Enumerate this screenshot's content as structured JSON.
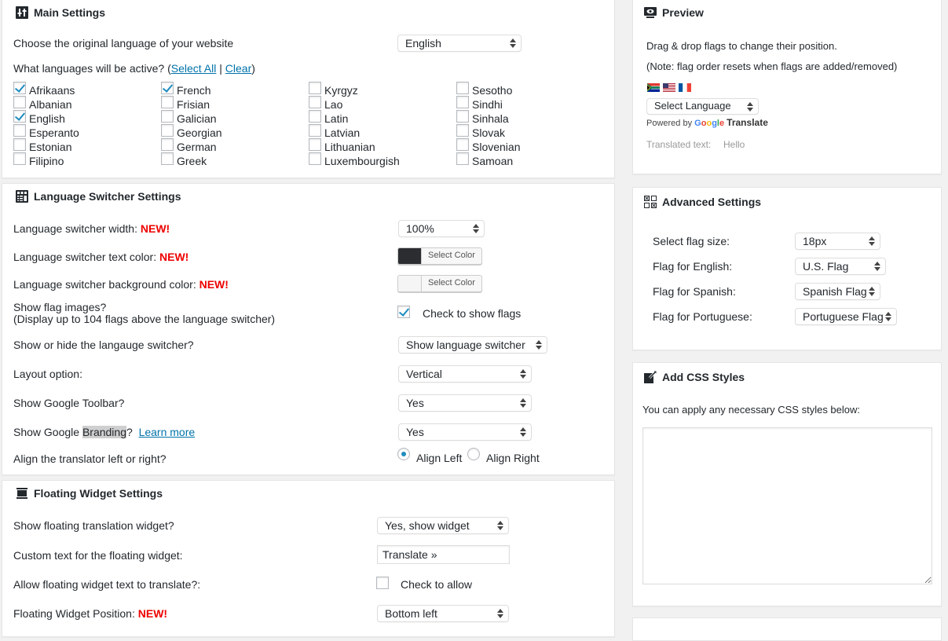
{
  "main_settings": {
    "title": "Main Settings",
    "icon": "sliders-icon",
    "original_language_label": "Choose the original language of your website",
    "original_language_value": "English",
    "active_languages_label": "What languages will be active? (",
    "select_all": "Select All",
    "separator": " | ",
    "clear": "Clear",
    "close_paren": ")",
    "languages": [
      [
        {
          "name": "Afrikaans",
          "checked": true
        },
        {
          "name": "Albanian",
          "checked": false
        },
        {
          "name": "English",
          "checked": true
        },
        {
          "name": "Esperanto",
          "checked": false
        },
        {
          "name": "Estonian",
          "checked": false
        },
        {
          "name": "Filipino",
          "checked": false
        }
      ],
      [
        {
          "name": "French",
          "checked": true
        },
        {
          "name": "Frisian",
          "checked": false
        },
        {
          "name": "Galician",
          "checked": false
        },
        {
          "name": "Georgian",
          "checked": false
        },
        {
          "name": "German",
          "checked": false
        },
        {
          "name": "Greek",
          "checked": false
        }
      ],
      [
        {
          "name": "Kyrgyz",
          "checked": false
        },
        {
          "name": "Lao",
          "checked": false
        },
        {
          "name": "Latin",
          "checked": false
        },
        {
          "name": "Latvian",
          "checked": false
        },
        {
          "name": "Lithuanian",
          "checked": false
        },
        {
          "name": "Luxembourgish",
          "checked": false
        }
      ],
      [
        {
          "name": "Sesotho",
          "checked": false
        },
        {
          "name": "Sindhi",
          "checked": false
        },
        {
          "name": "Sinhala",
          "checked": false
        },
        {
          "name": "Slovak",
          "checked": false
        },
        {
          "name": "Slovenian",
          "checked": false
        },
        {
          "name": "Samoan",
          "checked": false
        }
      ]
    ]
  },
  "switcher_settings": {
    "title": "Language Switcher Settings",
    "icon": "table-layout-icon",
    "new_badge": "NEW!",
    "width_label": "Language switcher width: ",
    "width_value": "100%",
    "text_color_label": "Language switcher text color: ",
    "text_color_value": "#2b2d31",
    "bg_color_label": "Language switcher background color: ",
    "bg_color_value": "#f5f5f5",
    "select_color": "Select Color",
    "show_flags_label_1": "Show flag images?",
    "show_flags_label_2": "(Display up to 104 flags above the language switcher)",
    "show_flags_checkbox": "Check to show flags",
    "show_flags_checked": true,
    "show_hide_label": "Show or hide the langauge switcher?",
    "show_hide_value": "Show language switcher",
    "layout_label": "Layout option:",
    "layout_value": "Vertical",
    "toolbar_label": "Show Google Toolbar?",
    "toolbar_value": "Yes",
    "branding_label_pre": "Show Google ",
    "branding_label_hl": "Branding",
    "branding_label_post": "?",
    "learn_more": "Learn more",
    "branding_value": "Yes",
    "align_label": "Align the translator left or right?",
    "align_left": "Align Left",
    "align_right": "Align Right",
    "align_selected": "left"
  },
  "floating_settings": {
    "title": "Floating Widget Settings",
    "icon": "floating-widget-icon",
    "show_widget_label": "Show floating translation widget?",
    "show_widget_value": "Yes, show widget",
    "custom_text_label": "Custom text for the floating widget:",
    "custom_text_value": "Translate »",
    "allow_translate_label": "Allow floating widget text to translate?:",
    "allow_translate_checkbox": "Check to allow",
    "allow_translate_checked": false,
    "position_label": "Floating Widget Position: ",
    "new_badge": "NEW!",
    "position_value": "Bottom left"
  },
  "preview": {
    "title": "Preview",
    "icon": "preview-screen-icon",
    "instructions": "Drag & drop flags to change their position.",
    "note": "(Note: flag order resets when flags are added/removed)",
    "flags": [
      "south-africa-flag-icon",
      "usa-flag-icon",
      "france-flag-icon"
    ],
    "select_language": "Select Language",
    "powered_by": "Powered by ",
    "google": "Google",
    "translate": "Translate",
    "translated_label": "Translated text:",
    "translated_value": "Hello"
  },
  "advanced": {
    "title": "Advanced Settings",
    "icon": "grid-icon",
    "flag_size_label": "Select flag size:",
    "flag_size_value": "18px",
    "flag_english_label": "Flag for English:",
    "flag_english_value": "U.S. Flag",
    "flag_spanish_label": "Flag for Spanish:",
    "flag_spanish_value": "Spanish Flag",
    "flag_portuguese_label": "Flag for Portuguese:",
    "flag_portuguese_value": "Portuguese Flag"
  },
  "css_styles": {
    "title": "Add CSS Styles",
    "icon": "edit-icon",
    "description": "You can apply any necessary CSS styles below:",
    "value": ""
  }
}
